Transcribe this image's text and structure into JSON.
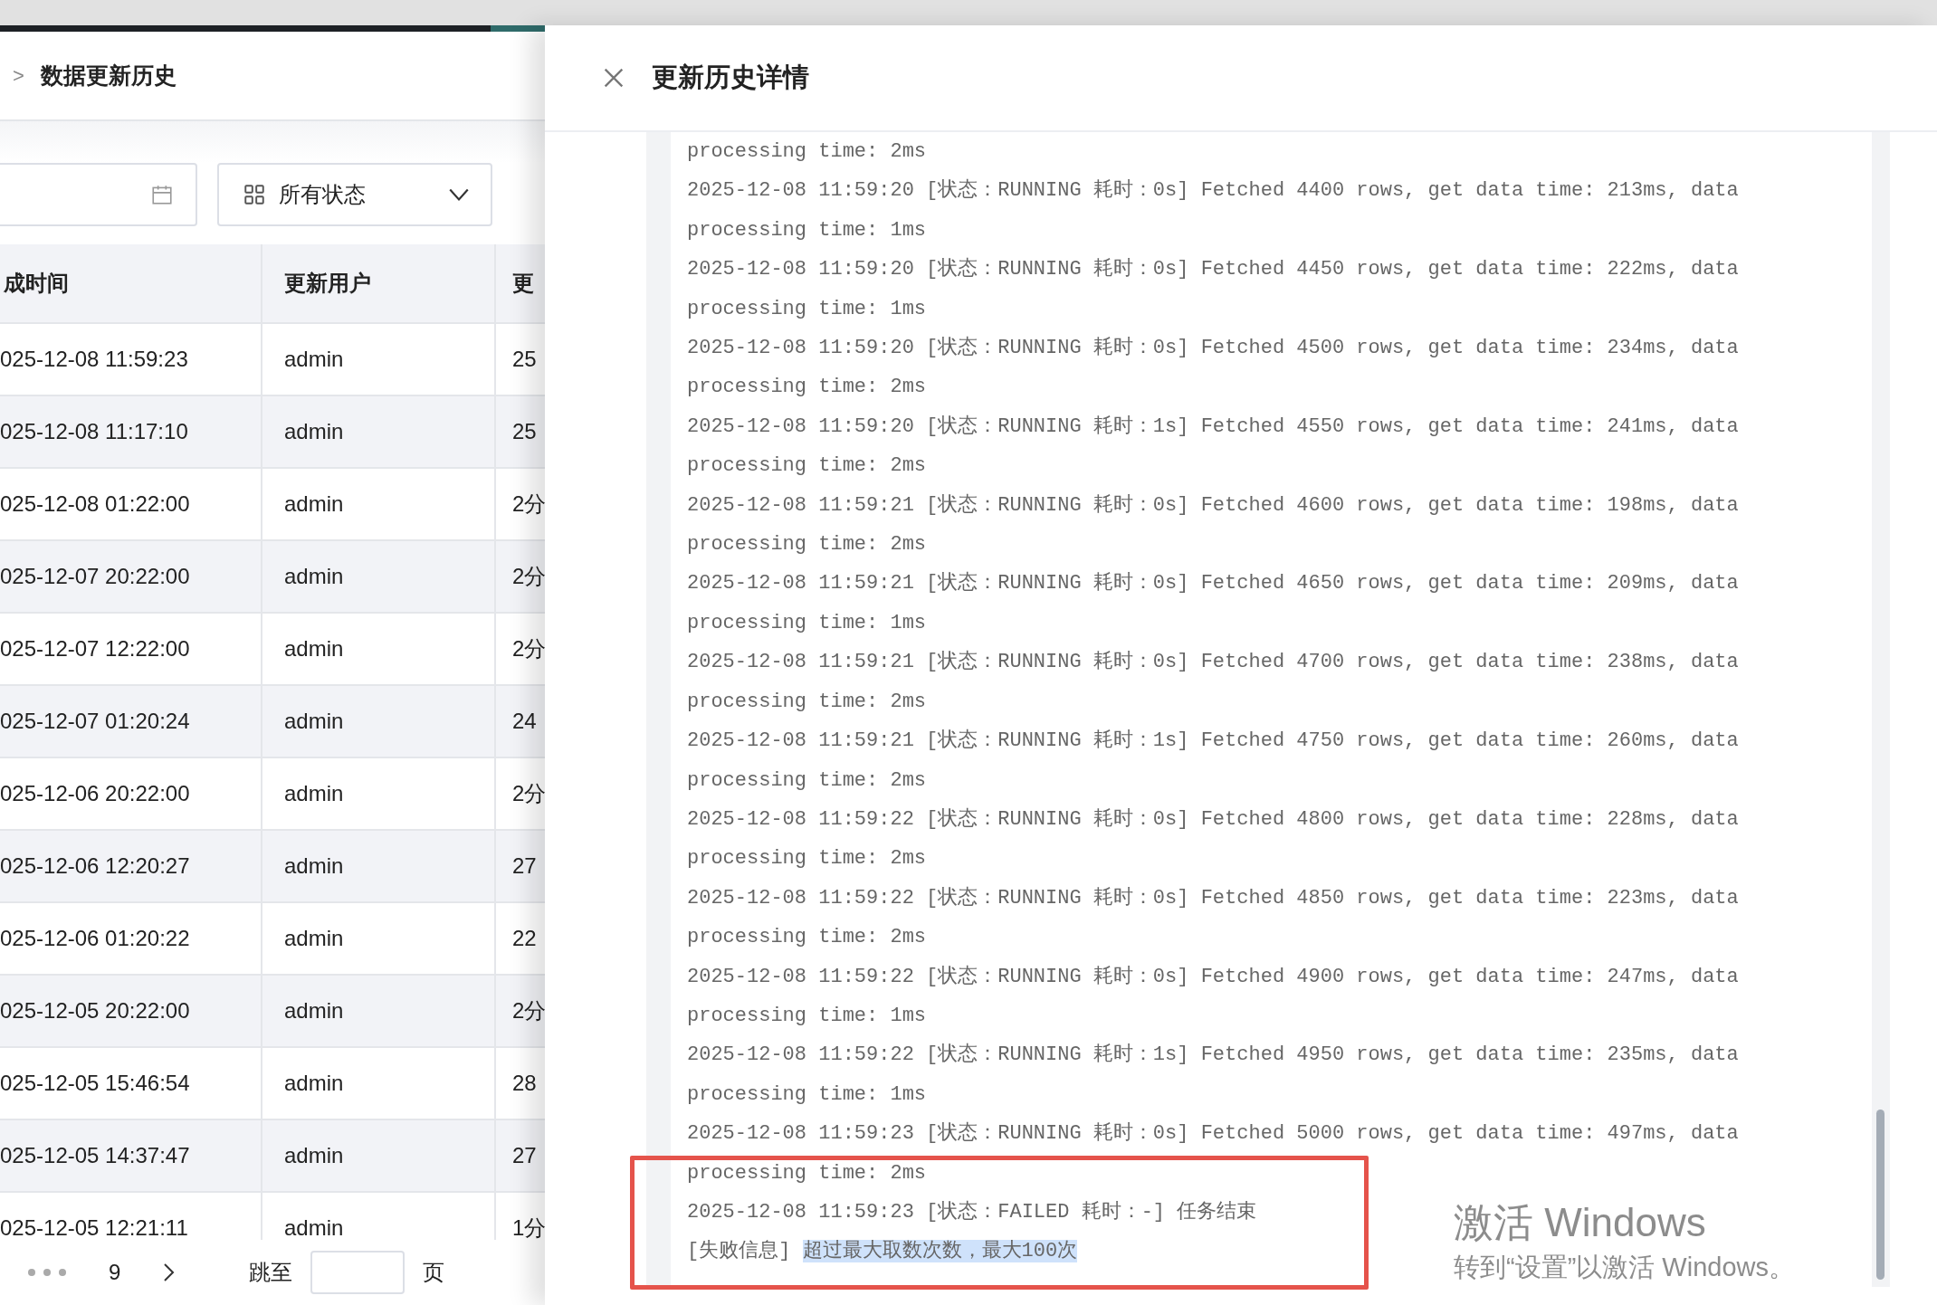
{
  "breadcrumb": {
    "separator": ">",
    "current": "数据更新历史"
  },
  "filters": {
    "status_select": {
      "value": "所有状态"
    }
  },
  "table": {
    "columns": [
      "成时间",
      "更新用户",
      "更"
    ],
    "rows": [
      {
        "cells": [
          "025-12-08 11:59:23",
          "admin",
          "25"
        ]
      },
      {
        "cells": [
          "025-12-08 11:17:10",
          "admin",
          "25"
        ]
      },
      {
        "cells": [
          "025-12-08 01:22:00",
          "admin",
          "2分"
        ]
      },
      {
        "cells": [
          "025-12-07 20:22:00",
          "admin",
          "2分"
        ]
      },
      {
        "cells": [
          "025-12-07 12:22:00",
          "admin",
          "2分"
        ]
      },
      {
        "cells": [
          "025-12-07 01:20:24",
          "admin",
          "24"
        ]
      },
      {
        "cells": [
          "025-12-06 20:22:00",
          "admin",
          "2分"
        ]
      },
      {
        "cells": [
          "025-12-06 12:20:27",
          "admin",
          "27"
        ]
      },
      {
        "cells": [
          "025-12-06 01:20:22",
          "admin",
          "22"
        ]
      },
      {
        "cells": [
          "025-12-05 20:22:00",
          "admin",
          "2分"
        ]
      },
      {
        "cells": [
          "025-12-05 15:46:54",
          "admin",
          "28"
        ]
      },
      {
        "cells": [
          "025-12-05 14:37:47",
          "admin",
          "27"
        ]
      },
      {
        "cells": [
          "025-12-05 12:21:11",
          "admin",
          "1分"
        ]
      }
    ]
  },
  "pagination": {
    "pages": [
      {
        "label": "9",
        "selected": false
      }
    ],
    "jump_label": "跳至",
    "page_suffix": "页"
  },
  "drawer": {
    "title": "更新历史详情",
    "log": [
      {
        "kind": "plain",
        "text": "processing time: 2ms"
      },
      {
        "kind": "plain",
        "text": "2025-12-08 11:59:20 [状态：RUNNING 耗时：0s] Fetched 4400 rows, get data time: 213ms, data processing time: 1ms"
      },
      {
        "kind": "plain",
        "text": "2025-12-08 11:59:20 [状态：RUNNING 耗时：0s] Fetched 4450 rows, get data time: 222ms, data processing time: 1ms"
      },
      {
        "kind": "plain",
        "text": "2025-12-08 11:59:20 [状态：RUNNING 耗时：0s] Fetched 4500 rows, get data time: 234ms, data processing time: 2ms"
      },
      {
        "kind": "plain",
        "text": "2025-12-08 11:59:20 [状态：RUNNING 耗时：1s] Fetched 4550 rows, get data time: 241ms, data processing time: 2ms"
      },
      {
        "kind": "plain",
        "text": "2025-12-08 11:59:21 [状态：RUNNING 耗时：0s] Fetched 4600 rows, get data time: 198ms, data processing time: 2ms"
      },
      {
        "kind": "plain",
        "text": "2025-12-08 11:59:21 [状态：RUNNING 耗时：0s] Fetched 4650 rows, get data time: 209ms, data processing time: 1ms"
      },
      {
        "kind": "plain",
        "text": "2025-12-08 11:59:21 [状态：RUNNING 耗时：0s] Fetched 4700 rows, get data time: 238ms, data processing time: 2ms"
      },
      {
        "kind": "plain",
        "text": "2025-12-08 11:59:21 [状态：RUNNING 耗时：1s] Fetched 4750 rows, get data time: 260ms, data processing time: 2ms"
      },
      {
        "kind": "plain",
        "text": "2025-12-08 11:59:22 [状态：RUNNING 耗时：0s] Fetched 4800 rows, get data time: 228ms, data processing time: 2ms"
      },
      {
        "kind": "plain",
        "text": "2025-12-08 11:59:22 [状态：RUNNING 耗时：0s] Fetched 4850 rows, get data time: 223ms, data processing time: 2ms"
      },
      {
        "kind": "plain",
        "text": "2025-12-08 11:59:22 [状态：RUNNING 耗时：0s] Fetched 4900 rows, get data time: 247ms, data processing time: 1ms"
      },
      {
        "kind": "plain",
        "text": "2025-12-08 11:59:22 [状态：RUNNING 耗时：1s] Fetched 4950 rows, get data time: 235ms, data processing time: 1ms"
      },
      {
        "kind": "plain",
        "text": "2025-12-08 11:59:23 [状态：RUNNING 耗时：0s] Fetched 5000 rows, get data time: 497ms, data processing time: 2ms"
      },
      {
        "kind": "plain",
        "text": "2025-12-08 11:59:23 [状态：FAILED 耗时：-] 任务结束"
      },
      {
        "kind": "error_info",
        "label": "[失败信息]",
        "message": "超过最大取数次数，最大100次",
        "highlighted": true
      }
    ]
  },
  "os_notice": {
    "title": "激活 Windows",
    "subtitle": "转到“设置”以激活 Windows。"
  }
}
